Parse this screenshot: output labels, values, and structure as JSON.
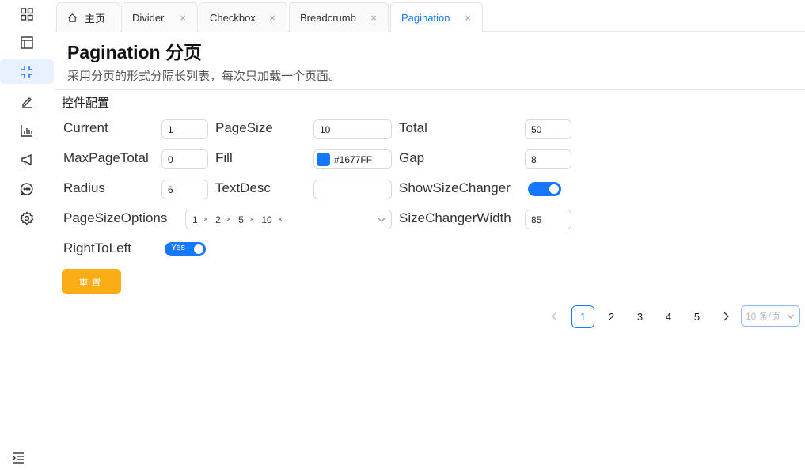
{
  "sidebar": {
    "items": [
      {
        "icon": "grid-icon"
      },
      {
        "icon": "layout-icon"
      },
      {
        "icon": "compress-icon",
        "active": true
      },
      {
        "icon": "edit-icon"
      },
      {
        "icon": "bar-chart-icon"
      },
      {
        "icon": "megaphone-icon"
      },
      {
        "icon": "chat-icon"
      },
      {
        "icon": "gear-icon"
      }
    ],
    "collapse_icon": "menu-fold-icon"
  },
  "tabs": [
    {
      "label": "主页",
      "icon": "home-icon",
      "closable": false
    },
    {
      "label": "Divider",
      "closable": true
    },
    {
      "label": "Checkbox",
      "closable": true
    },
    {
      "label": "Breadcrumb",
      "closable": true
    },
    {
      "label": "Pagination",
      "closable": true,
      "active": true
    }
  ],
  "close_glyph": "×",
  "header": {
    "title": "Pagination 分页",
    "description": "采用分页的形式分隔长列表，每次只加载一个页面。"
  },
  "config": {
    "section_label": "控件配置",
    "current": {
      "label": "Current",
      "value": "1"
    },
    "page_size": {
      "label": "PageSize",
      "value": "10"
    },
    "total": {
      "label": "Total",
      "value": "50"
    },
    "max_page_total": {
      "label": "MaxPageTotal",
      "value": "0"
    },
    "fill": {
      "label": "Fill",
      "value": "#1677FF"
    },
    "gap": {
      "label": "Gap",
      "value": "8"
    },
    "radius": {
      "label": "Radius",
      "value": "6"
    },
    "text_desc": {
      "label": "TextDesc",
      "value": ""
    },
    "show_size_changer": {
      "label": "ShowSizeChanger",
      "checked": true
    },
    "page_size_options": {
      "label": "PageSizeOptions",
      "tags": [
        "1",
        "2",
        "5",
        "10"
      ]
    },
    "size_changer_width": {
      "label": "SizeChangerWidth",
      "value": "85"
    },
    "right_to_left": {
      "label": "RightToLeft",
      "checked": true,
      "on_text": "Yes"
    },
    "reset_label": "重置"
  },
  "pagination": {
    "pages": [
      "1",
      "2",
      "3",
      "4",
      "5"
    ],
    "current": "1",
    "size_selector": "10 条/页"
  },
  "colors": {
    "accent": "#1677FF",
    "warning": "#FAAD14"
  }
}
